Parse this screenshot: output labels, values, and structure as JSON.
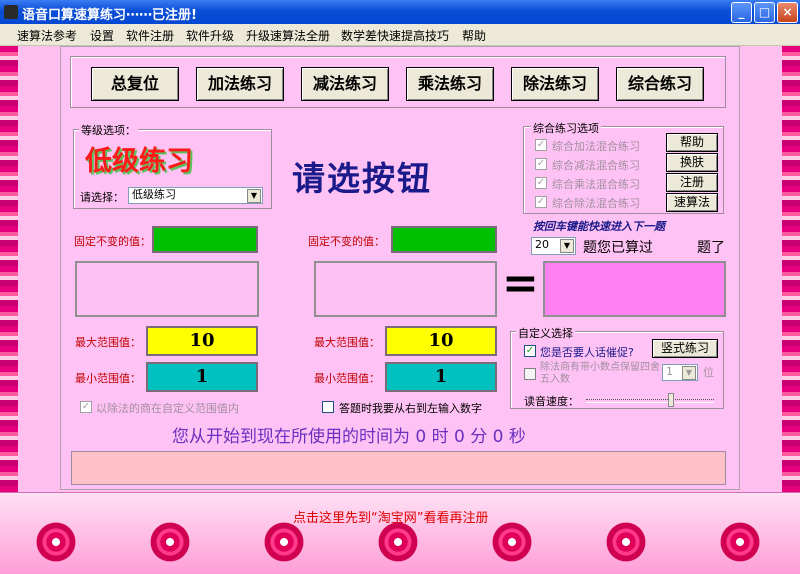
{
  "window": {
    "title": "语音口算速算练习⋯⋯已注册!",
    "min": "_",
    "max": "□",
    "close": "×"
  },
  "menu": [
    "速算法参考",
    "设置",
    "软件注册",
    "软件升级",
    "升级速算法全册",
    "数学差快速提高技巧",
    "帮助"
  ],
  "top_buttons": [
    "总复位",
    "加法练习",
    "减法练习",
    "乘法练习",
    "除法练习",
    "综合练习"
  ],
  "level": {
    "group_label": "等级选项：",
    "banner": "低级练习",
    "select_label": "请选择：",
    "select_value": "低级练习"
  },
  "prompt": "请选按钮",
  "mix": {
    "group_label": "综合练习选项",
    "options": [
      "综合加法混合练习",
      "综合减法混合练习",
      "综合乘法混合练习",
      "综合除法混合练习"
    ],
    "buttons": [
      "帮助",
      "换肤",
      "注册",
      "速算法"
    ]
  },
  "hint": "按回车键能快速进入下一题",
  "count": {
    "value": "20",
    "label1": "题您已算过",
    "label2": "题了"
  },
  "left": {
    "fixed_label": "固定不变的值：",
    "max_label": "最大范围值：",
    "max_value": "10",
    "min_label": "最小范围值：",
    "min_value": "1"
  },
  "right": {
    "fixed_label": "固定不变的值：",
    "max_label": "最大范围值：",
    "max_value": "10",
    "min_label": "最小范围值：",
    "min_value": "1"
  },
  "equals": "=",
  "custom": {
    "group_label": "自定义选择",
    "urge_label": "您是否要人话催促?",
    "vertical_button": "竖式练习",
    "decimal_label": "除法商有带小数点保留四舍五入数",
    "decimal_value": "1",
    "decimal_unit": "位",
    "speed_label": "读音速度："
  },
  "checkbox_divisor": "以除法的商在自定义范围值内",
  "checkbox_rtl": "答题时我要从右到左输入数字",
  "timer": "您从开始到现在所使用的时间为 0 时 0 分 0 秒",
  "footer_link": "点击这里先到“淘宝网”看看再注册",
  "colors": {
    "title_bar": "#0548d2",
    "panel": "#ffc2f4",
    "yellow": "#ffff00",
    "teal": "#00c0c0",
    "green": "#00c000",
    "magenta": "#ff80f0",
    "navy": "#1a1a8a"
  }
}
